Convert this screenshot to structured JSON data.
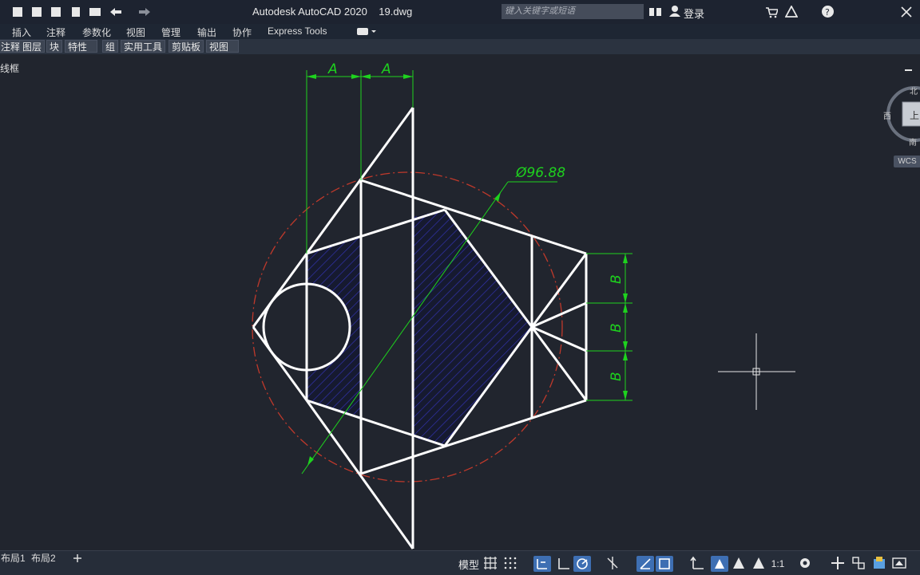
{
  "titlebar": {
    "app_title": "Autodesk AutoCAD 2020",
    "file_name": "19.dwg",
    "search_placeholder": "键入关键字或短语",
    "login_label": "登录"
  },
  "menu": {
    "items": [
      "插入",
      "注释",
      "参数化",
      "视图",
      "管理",
      "输出",
      "协作",
      "Express Tools"
    ]
  },
  "ribbon": {
    "panels": [
      "注释",
      "图层",
      "块",
      "特性",
      "组",
      "实用工具",
      "剪贴板",
      "视图"
    ]
  },
  "viewport": {
    "label": "线框"
  },
  "viewcube": {
    "north": "北",
    "west": "西",
    "south": "南",
    "face": "上",
    "wcs": "WCS"
  },
  "drawing": {
    "dim_a1": "A",
    "dim_a2": "A",
    "dim_b1": "B",
    "dim_b2": "B",
    "dim_b3": "B",
    "diameter": "Ø96.88",
    "colors": {
      "geometry": "#ffffff",
      "dimension": "#1ed21e",
      "hatch": "#2b2b9e",
      "circle_dashed": "#c0392b"
    }
  },
  "layout_tabs": [
    "布局1",
    "布局2"
  ],
  "status": {
    "model_label": "模型",
    "scale_label": "1:1"
  }
}
